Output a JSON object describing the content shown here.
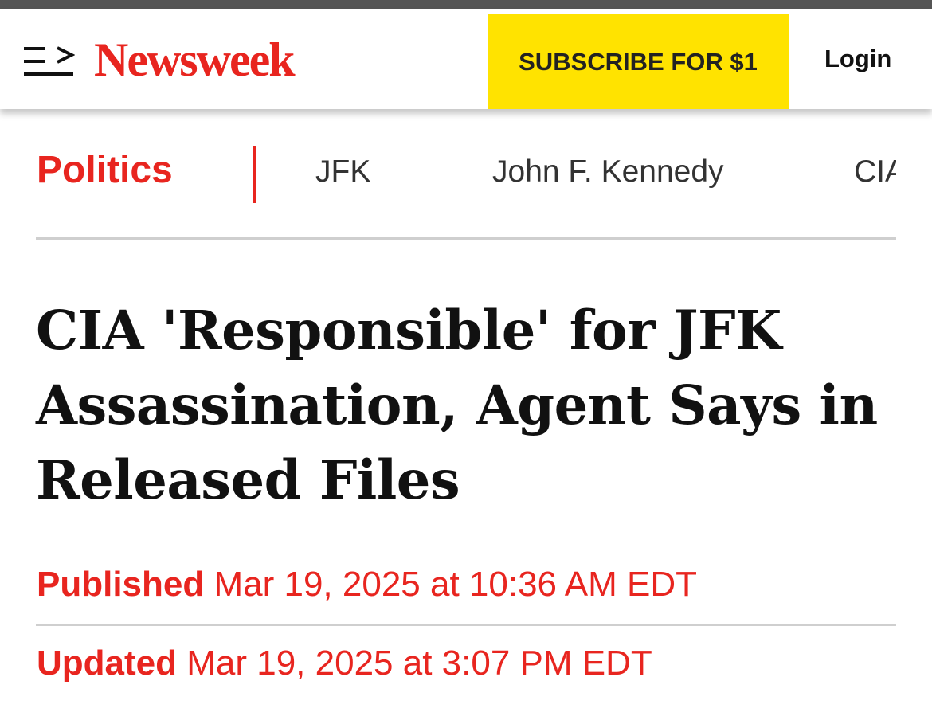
{
  "header": {
    "brand": "Newsweek",
    "subscribe_label": "SUBSCRIBE FOR $1",
    "login_label": "Login",
    "menu_icon": "menu-icon"
  },
  "topics": {
    "primary": "Politics",
    "links": [
      "JFK",
      "John F. Kennedy",
      "CIA"
    ]
  },
  "article": {
    "headline": "CIA 'Responsible' for JFK Assassination, Agent Says in Released Files",
    "published_label": "Published",
    "published_value": "Mar 19, 2025 at 10:36 AM EDT",
    "updated_label": "Updated",
    "updated_value": "Mar 19, 2025 at 3:07 PM EDT"
  },
  "colors": {
    "brand_red": "#e8251f",
    "subscribe_yellow": "#ffe300"
  }
}
